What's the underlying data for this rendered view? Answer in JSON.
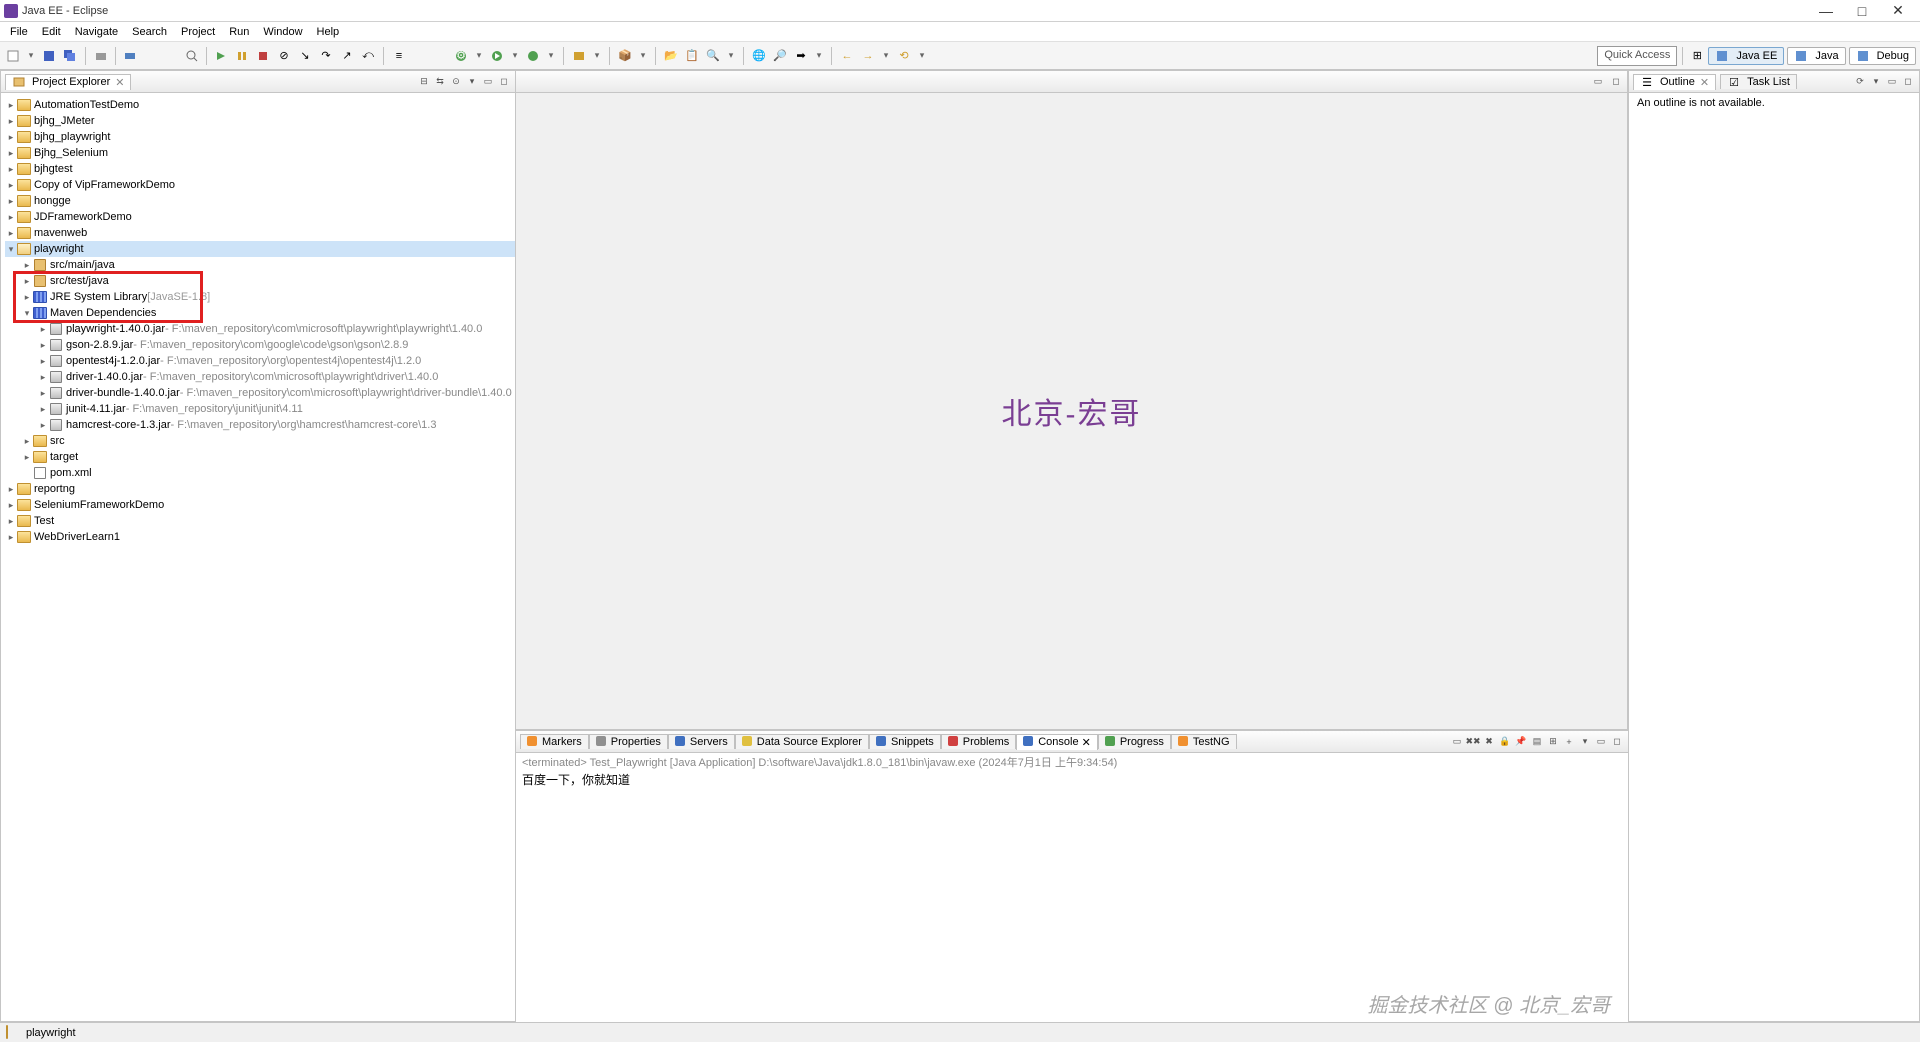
{
  "window": {
    "title": "Java EE - Eclipse"
  },
  "menu": [
    "File",
    "Edit",
    "Navigate",
    "Search",
    "Project",
    "Run",
    "Window",
    "Help"
  ],
  "quick_access_placeholder": "Quick Access",
  "perspectives": [
    {
      "label": "Java EE",
      "active": true
    },
    {
      "label": "Java",
      "active": false
    },
    {
      "label": "Debug",
      "active": false
    }
  ],
  "project_explorer": {
    "title": "Project Explorer",
    "nodes": [
      {
        "label": "AutomationTestDemo",
        "icon": "folder-closed"
      },
      {
        "label": "bjhg_JMeter",
        "icon": "folder-closed"
      },
      {
        "label": "bjhg_playwright",
        "icon": "folder-closed"
      },
      {
        "label": "Bjhg_Selenium",
        "icon": "folder-closed"
      },
      {
        "label": "bjhgtest",
        "icon": "folder-closed"
      },
      {
        "label": "Copy of VipFrameworkDemo",
        "icon": "folder-closed"
      },
      {
        "label": "hongge",
        "icon": "folder-closed"
      },
      {
        "label": "JDFrameworkDemo",
        "icon": "folder-closed"
      },
      {
        "label": "mavenweb",
        "icon": "folder-closed"
      },
      {
        "label": "playwright",
        "icon": "folder-open",
        "expanded": true,
        "selected": true,
        "children": [
          {
            "label": "src/main/java",
            "icon": "pkg-icon"
          },
          {
            "label": "src/test/java",
            "icon": "pkg-icon"
          },
          {
            "label": "JRE System Library",
            "qualifier": "[JavaSE-1.8]",
            "icon": "lib-icon"
          },
          {
            "label": "Maven Dependencies",
            "icon": "lib-icon",
            "expanded": true,
            "children": [
              {
                "label": "playwright-1.40.0.jar",
                "path": "F:\\maven_repository\\com\\microsoft\\playwright\\playwright\\1.40.0",
                "icon": "jar-icon"
              },
              {
                "label": "gson-2.8.9.jar",
                "path": "F:\\maven_repository\\com\\google\\code\\gson\\gson\\2.8.9",
                "icon": "jar-icon"
              },
              {
                "label": "opentest4j-1.2.0.jar",
                "path": "F:\\maven_repository\\org\\opentest4j\\opentest4j\\1.2.0",
                "icon": "jar-icon"
              },
              {
                "label": "driver-1.40.0.jar",
                "path": "F:\\maven_repository\\com\\microsoft\\playwright\\driver\\1.40.0",
                "icon": "jar-icon"
              },
              {
                "label": "driver-bundle-1.40.0.jar",
                "path": "F:\\maven_repository\\com\\microsoft\\playwright\\driver-bundle\\1.40.0",
                "icon": "jar-icon"
              },
              {
                "label": "junit-4.11.jar",
                "path": "F:\\maven_repository\\junit\\junit\\4.11",
                "icon": "jar-icon"
              },
              {
                "label": "hamcrest-core-1.3.jar",
                "path": "F:\\maven_repository\\org\\hamcrest\\hamcrest-core\\1.3",
                "icon": "jar-icon"
              }
            ]
          },
          {
            "label": "src",
            "icon": "folder-closed"
          },
          {
            "label": "target",
            "icon": "folder-closed"
          },
          {
            "label": "pom.xml",
            "icon": "xml-icon",
            "leaf": true
          }
        ]
      },
      {
        "label": "reportng",
        "icon": "folder-closed"
      },
      {
        "label": "SeleniumFrameworkDemo",
        "icon": "folder-closed"
      },
      {
        "label": "Test",
        "icon": "folder-closed"
      },
      {
        "label": "WebDriverLearn1",
        "icon": "folder-closed"
      }
    ]
  },
  "editor_watermark": "北京-宏哥",
  "outline": {
    "title": "Outline",
    "task_list": "Task List",
    "empty": "An outline is not available."
  },
  "console": {
    "tabs": [
      {
        "label": "Markers",
        "icon": "ic-orange"
      },
      {
        "label": "Properties",
        "icon": "ic-gray"
      },
      {
        "label": "Servers",
        "icon": "ic-blue"
      },
      {
        "label": "Data Source Explorer",
        "icon": "ic-yellow"
      },
      {
        "label": "Snippets",
        "icon": "ic-blue"
      },
      {
        "label": "Problems",
        "icon": "ic-red"
      },
      {
        "label": "Console",
        "icon": "ic-blue",
        "active": true
      },
      {
        "label": "Progress",
        "icon": "ic-green"
      },
      {
        "label": "TestNG",
        "icon": "ic-orange"
      }
    ],
    "status": "<terminated> Test_Playwright [Java Application] D:\\software\\Java\\jdk1.8.0_181\\bin\\javaw.exe (2024年7月1日 上午9:34:54)",
    "output": "百度一下，你就知道"
  },
  "corner_watermark": "掘金技术社区 @ 北京_宏哥",
  "status_bar": {
    "project": "playwright"
  },
  "highlight": {
    "rows": [
      "src/test/java",
      "JRE System Library",
      "Maven Dependencies"
    ]
  }
}
